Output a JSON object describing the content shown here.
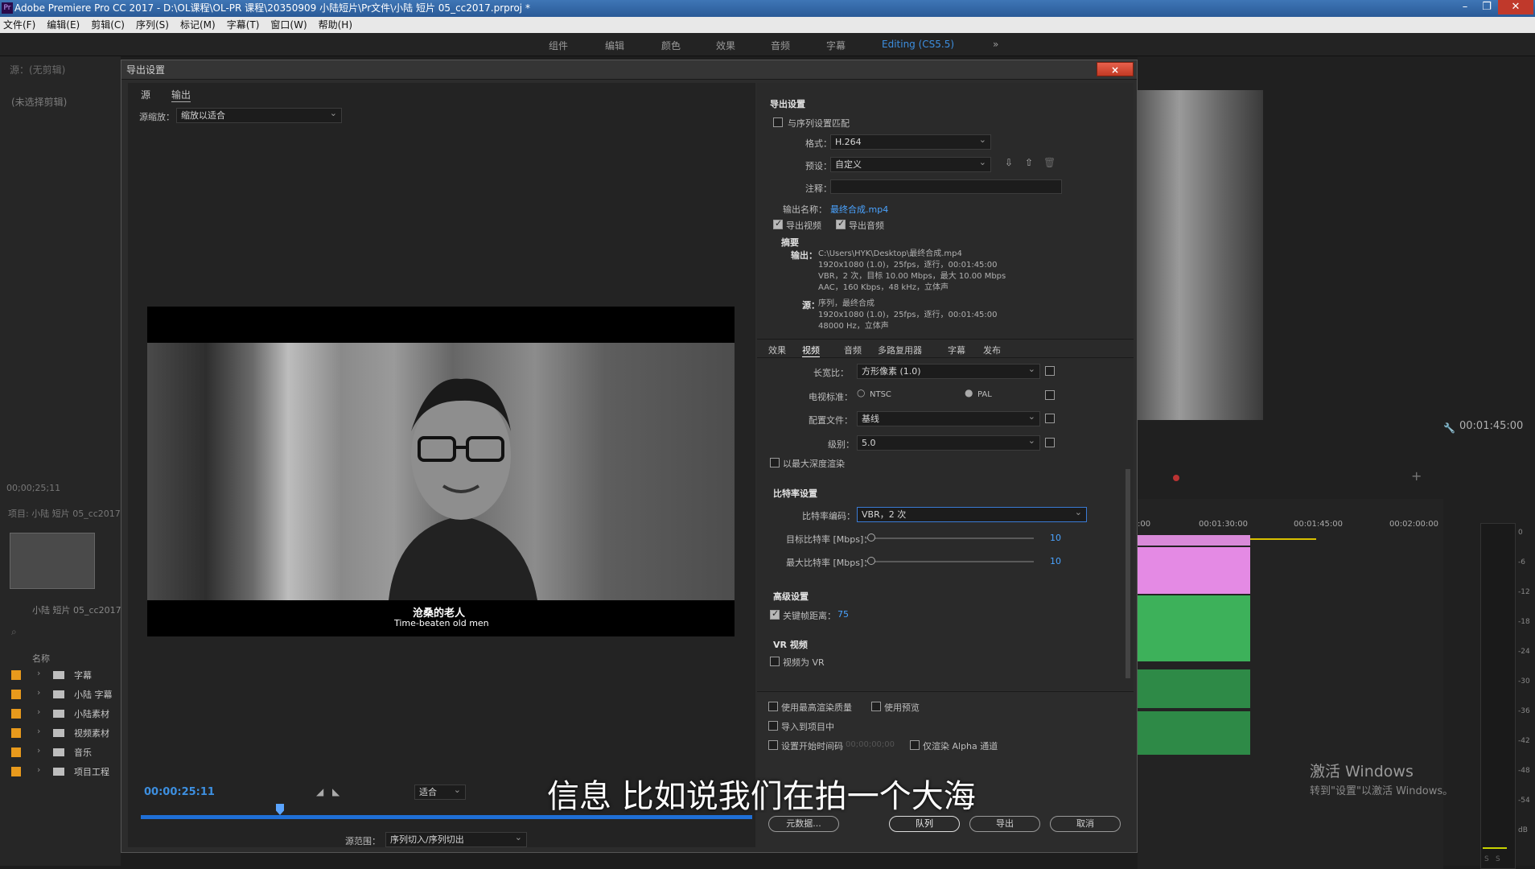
{
  "app": {
    "title": "Adobe Premiere Pro CC 2017 - D:\\OL课程\\OL-PR 课程\\20350909 小陆短片\\Pr文件\\小陆 短片 05_cc2017.prproj *",
    "menus": [
      "文件(F)",
      "编辑(E)",
      "剪辑(C)",
      "序列(S)",
      "标记(M)",
      "字幕(T)",
      "窗口(W)",
      "帮助(H)"
    ],
    "workspaces": [
      "组件",
      "编辑",
      "颜色",
      "效果",
      "音频",
      "字幕",
      "Editing (CS5.5)",
      "»"
    ]
  },
  "left_panel": {
    "source_label": "源：(无剪辑)",
    "no_clip": "(未选择剪辑)",
    "timecode": "00;00;25;11",
    "project_label": "项目: 小陆 短片 05_cc2017",
    "sequence_name": "小陆 短片 05_cc2017",
    "name_header": "名称",
    "bins": [
      "字幕",
      "小陆 字幕",
      "小陆素材",
      "视频素材",
      "音乐",
      "项目工程"
    ]
  },
  "dialog": {
    "title": "导出设置",
    "close": "×",
    "tabs": [
      "源",
      "输出"
    ],
    "source_scaling_label": "源缩放：",
    "source_scaling_value": "缩放以适合",
    "subtitle_cn": "沧桑的老人",
    "subtitle_en": "Time-beaten old men",
    "timecode": "00:00:25:11",
    "fit_value": "适合",
    "source_range_label": "源范围：",
    "source_range_value": "序列切入/序列切出",
    "export_settings": {
      "header": "导出设置",
      "match_sequence": "与序列设置匹配",
      "format_label": "格式：",
      "format_value": "H.264",
      "preset_label": "预设：",
      "preset_value": "自定义",
      "comments_label": "注释：",
      "output_name_label": "输出名称：",
      "output_name_value": "最终合成.mp4",
      "export_video": "导出视频",
      "export_audio": "导出音频",
      "summary_header": "摘要",
      "output_label": "输出：",
      "output_lines": [
        "C:\\Users\\HYK\\Desktop\\最终合成.mp4",
        "1920x1080 (1.0)，25fps，逐行，00:01:45:00",
        "VBR，2 次，目标 10.00 Mbps，最大 10.00 Mbps",
        "AAC，160 Kbps，48 kHz，立体声"
      ],
      "source_label": "源：",
      "source_lines": [
        "序列，最终合成",
        "1920x1080 (1.0)，25fps，逐行，00:01:45:00",
        "48000 Hz，立体声"
      ]
    },
    "subtabs": [
      "效果",
      "视频",
      "音频",
      "多路复用器",
      "字幕",
      "发布"
    ],
    "video": {
      "aspect_label": "长宽比：",
      "aspect_value": "方形像素 (1.0)",
      "tv_label": "电视标准：",
      "ntsc": "NTSC",
      "pal": "PAL",
      "profile_label": "配置文件：",
      "profile_value": "基线",
      "level_label": "级别：",
      "level_value": "5.0",
      "max_depth": "以最大深度渲染"
    },
    "bitrate": {
      "header": "比特率设置",
      "encoding_label": "比特率编码：",
      "encoding_value": "VBR，2 次",
      "target_label": "目标比特率 [Mbps]：",
      "target_value": "10",
      "max_label": "最大比特率 [Mbps]：",
      "max_value": "10"
    },
    "advanced": {
      "header": "高级设置",
      "keyframe_label": "关键帧距离：",
      "keyframe_value": "75"
    },
    "vr": {
      "header": "VR 视频",
      "as_vr": "视频为 VR"
    },
    "bottom": {
      "max_quality": "使用最高渲染质量",
      "use_previews": "使用预览",
      "import_project": "导入到项目中",
      "set_start_tc": "设置开始时间码",
      "start_tc_value": "00;00;00;00",
      "alpha_only": "仅渲染 Alpha 通道",
      "metadata_btn": "元数据...",
      "queue_btn": "队列",
      "export_btn": "导出",
      "cancel_btn": "取消"
    }
  },
  "right_panel": {
    "program_timecode": "00:01:45:00",
    "ruler": [
      ":00",
      "00:01:30:00",
      "00:01:45:00",
      "00:02:00:00"
    ],
    "meter_scale": [
      "0",
      "-6",
      "-12",
      "-18",
      "-24",
      "-30",
      "-36",
      "-42",
      "-48",
      "-54",
      "dB"
    ],
    "meter_footer": [
      "S",
      "S"
    ]
  },
  "watermark": {
    "line1": "激活 Windows",
    "line2": "转到\"设置\"以激活 Windows。"
  },
  "overlay_subtitle": "信息 比如说我们在拍一个大海"
}
